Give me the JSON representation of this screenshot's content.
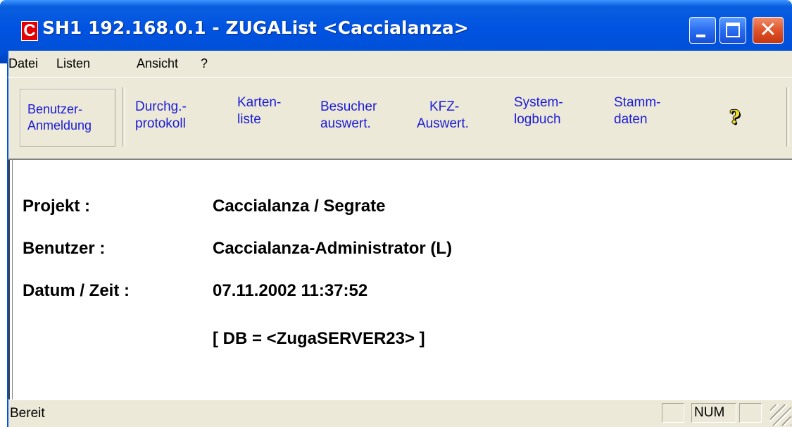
{
  "window": {
    "title": "SH1 192.168.0.1 - ZUGAList <Caccialanza>",
    "app_icon_letter": "C",
    "title_color": "#0053e1"
  },
  "menu": {
    "items": [
      "Datei",
      "Listen",
      "Ansicht",
      "?"
    ]
  },
  "toolbar": {
    "buttons": [
      {
        "line1": "Benutzer-",
        "line2": "Anmeldung"
      },
      {
        "line1": "Durchg.-",
        "line2": "protokoll"
      },
      {
        "line1": "Karten-",
        "line2": "liste"
      },
      {
        "line1": "Besucher",
        "line2": "auswert."
      },
      {
        "line1": "KFZ-",
        "line2": "Auswert."
      },
      {
        "line1": "System-",
        "line2": "logbuch"
      },
      {
        "line1": "Stamm-",
        "line2": "daten"
      }
    ],
    "help_icon": "help-question-icon",
    "help_glyph": "?"
  },
  "info": {
    "project_label": "Projekt :",
    "project_value": "Caccialanza / Segrate",
    "user_label": "Benutzer :",
    "user_value": "Caccialanza-Administrator (L)",
    "datetime_label": "Datum / Zeit :",
    "datetime_value": "07.11.2002 11:37:52",
    "db_value": "[ DB = <ZugaSERVER23> ]"
  },
  "status": {
    "text": "Bereit",
    "num": "NUM"
  }
}
